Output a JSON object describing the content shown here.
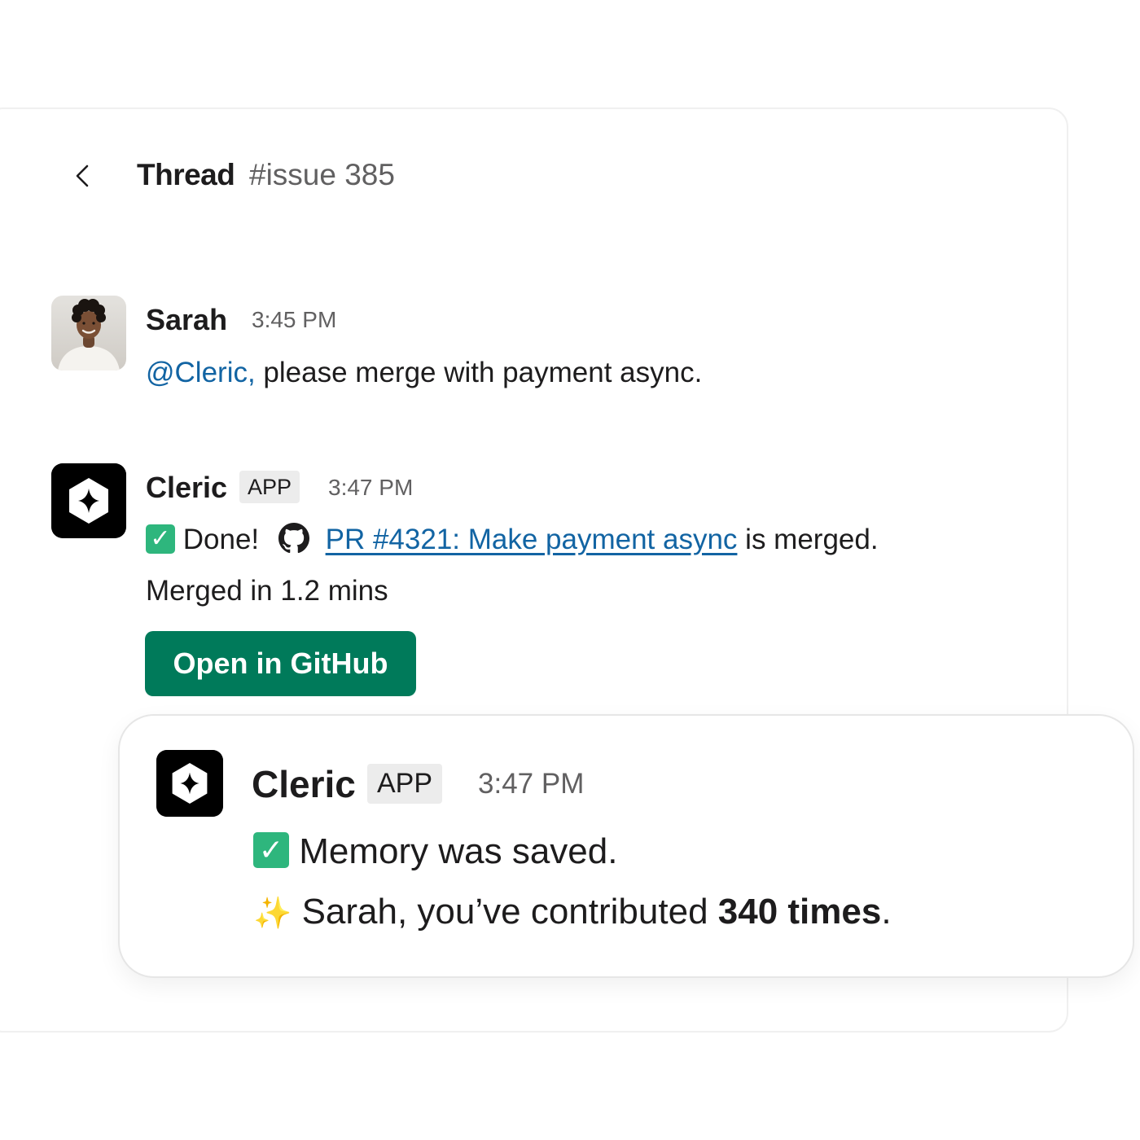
{
  "header": {
    "title": "Thread",
    "channel": "#issue 385"
  },
  "messages": [
    {
      "sender": "Sarah",
      "time": "3:45 PM",
      "mention": "@Cleric,",
      "text": " please merge with payment async."
    },
    {
      "sender": "Cleric",
      "badge": "APP",
      "time": "3:47 PM",
      "status_emoji": "✓",
      "done_text": "Done!",
      "pr_link": "PR #4321: Make payment async",
      "after_link": " is merged.",
      "detail": "Merged in 1.2 mins",
      "button_label": "Open in GitHub"
    }
  ],
  "memory_card": {
    "sender": "Cleric",
    "badge": "APP",
    "time": "3:47 PM",
    "status_emoji": "✓",
    "line1": "Memory was saved.",
    "sparkle_emoji": "✨",
    "line2_prefix": "Sarah, you’ve contributed ",
    "line2_bold": "340 times",
    "line2_suffix": "."
  },
  "colors": {
    "link": "#1264a3",
    "button": "#007a5a",
    "check": "#2eb67d"
  },
  "icons": [
    "chevron-left-icon",
    "cleric-logo-icon",
    "github-icon",
    "check-icon",
    "sparkles-icon"
  ]
}
